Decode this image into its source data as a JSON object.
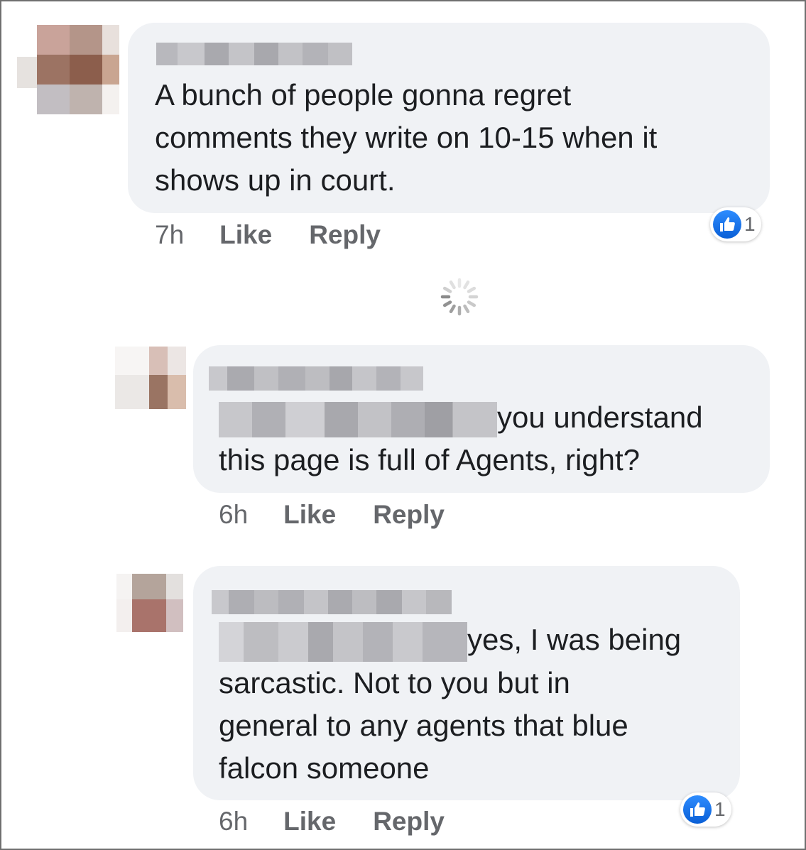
{
  "comments": [
    {
      "text_lines": [
        "A bunch of people gonna regret",
        "comments they write on 10-15 when it",
        "shows up in court."
      ],
      "time": "7h",
      "like_label": "Like",
      "reply_label": "Reply",
      "reaction_count": "1"
    },
    {
      "text_lines": [
        "you understand",
        "this page is full of Agents, right?"
      ],
      "time": "6h",
      "like_label": "Like",
      "reply_label": "Reply"
    },
    {
      "text_lines": [
        "yes, I was being",
        "sarcastic.  Not to you but in",
        "general to any agents that blue",
        "falcon someone"
      ],
      "time": "6h",
      "like_label": "Like",
      "reply_label": "Reply",
      "reaction_count": "1"
    }
  ],
  "icons": {
    "reaction": "like-thumbs-up-icon",
    "loading": "loading-spinner-icon"
  },
  "colors": {
    "bubble": "#f0f2f5",
    "like_blue": "#1877f2",
    "meta_gray": "#65676b"
  }
}
